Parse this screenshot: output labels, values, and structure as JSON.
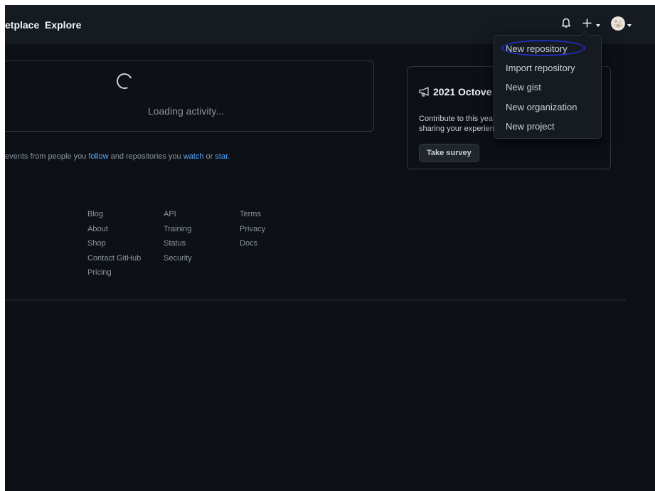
{
  "header": {
    "nav": [
      "etplace",
      "Explore"
    ],
    "icons": [
      "bell-icon",
      "plus-icon",
      "avatar"
    ]
  },
  "activity": {
    "loading_text": "Loading activity...",
    "hint": {
      "prefix": "events from people you",
      "follow": "follow",
      "middle": "and repositories you",
      "watch": "watch",
      "or": "or",
      "star": "star",
      "suffix": "."
    }
  },
  "survey": {
    "title": "2021 Octove",
    "text_line1": "Contribute to this yea",
    "text_line2": "sharing your experien",
    "button": "Take survey"
  },
  "footer": {
    "col1": [
      "Blog",
      "About",
      "Shop",
      "Contact GitHub",
      "Pricing"
    ],
    "col2": [
      "API",
      "Training",
      "Status",
      "Security"
    ],
    "col3": [
      "Terms",
      "Privacy",
      "Docs"
    ]
  },
  "dropdown": {
    "items": [
      "New repository",
      "Import repository",
      "New gist",
      "New organization",
      "New project"
    ]
  },
  "colors": {
    "background": "#0d1117",
    "header": "#161b22",
    "link": "#58a6ff",
    "highlight_ring": "#1f2fbd"
  }
}
